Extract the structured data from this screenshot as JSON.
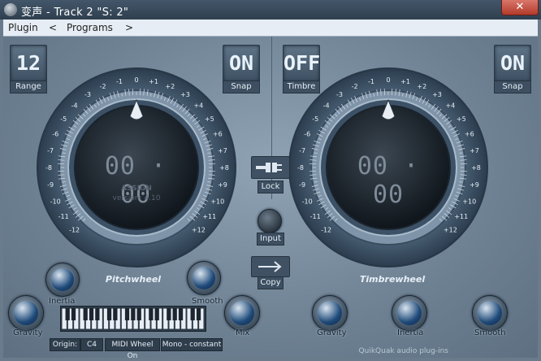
{
  "window": {
    "title": "变声 - Track 2  \"S: 2\"",
    "close_glyph": "✕"
  },
  "menu": {
    "plugin": "Plugin",
    "prev": "<",
    "programs": "Programs",
    "next": ">"
  },
  "pitch": {
    "range_value": "12",
    "range_label": "Range",
    "snap_value": "ON",
    "snap_label": "Snap",
    "display": "00 · 00",
    "assign": "ASSIGN",
    "version": "version: 4.10",
    "wheel_label": "Pitchwheel",
    "ticks": [
      "-12",
      "-11",
      "-10",
      "-9",
      "-8",
      "-7",
      "-6",
      "-5",
      "-4",
      "-3",
      "-2",
      "-1",
      "0",
      "+1",
      "+2",
      "+3",
      "+4",
      "+5",
      "+6",
      "+7",
      "+8",
      "+9",
      "+10",
      "+11",
      "+12"
    ]
  },
  "timbre": {
    "timbre_value": "OFF",
    "timbre_label": "Timbre",
    "snap_value": "ON",
    "snap_label": "Snap",
    "display": "00 · 00",
    "wheel_label": "Timbrewheel",
    "ticks": [
      "-12",
      "-11",
      "-10",
      "-9",
      "-8",
      "-7",
      "-6",
      "-5",
      "-4",
      "-3",
      "-2",
      "-1",
      "0",
      "+1",
      "+2",
      "+3",
      "+4",
      "+5",
      "+6",
      "+7",
      "+8",
      "+9",
      "+10",
      "+11",
      "+12"
    ]
  },
  "center": {
    "lock": "Lock",
    "input": "Input",
    "copy": "Copy"
  },
  "knobs": {
    "left": {
      "inertia": "Inertia",
      "smooth": "Smooth",
      "gravity": "Gravity",
      "mix": "Mix"
    },
    "right": {
      "gravity": "Gravity",
      "inertia": "Inertia",
      "smooth": "Smooth"
    }
  },
  "info": {
    "origin_label": "Origin:",
    "origin_value": "C4",
    "midi": "MIDI Wheel On",
    "mode": "Mono - constant"
  },
  "footer": "QuikQuak audio plug-ins",
  "colors": {
    "accent": "#1e4a7a",
    "lcd_text": "#e9f2fa",
    "panel": "#7d91a3"
  }
}
